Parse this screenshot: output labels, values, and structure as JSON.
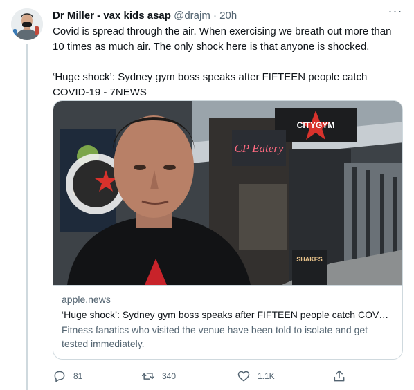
{
  "tweet": {
    "display_name": "Dr Miller - vax kids asap",
    "handle": "@drajm",
    "separator": "·",
    "time": "20h",
    "more": "···",
    "text_paragraph_1": "Covid is spread through the air. When exercising we breath out more than 10 times as much air. The only shock here is that anyone is shocked.",
    "text_paragraph_2": "‘Huge shock’: Sydney gym boss speaks after FIFTEEN people catch COVID-19 - 7NEWS"
  },
  "card": {
    "domain": "apple.news",
    "title": "‘Huge shock’: Sydney gym boss speaks after FIFTEEN people catch COV…",
    "description": "Fitness fanatics who visited the venue have been told to isolate and get tested immediately.",
    "image_signs": {
      "gym_sign": "CITYGYM",
      "eatery_sign": "CP Eatery",
      "board_sign": "SHAKES"
    }
  },
  "actions": {
    "reply_count": "81",
    "retweet_count": "340",
    "like_count": "1.1K"
  },
  "icons": {
    "reply": "reply-icon",
    "retweet": "retweet-icon",
    "like": "heart-icon",
    "share": "share-icon"
  },
  "colors": {
    "text": "#0f1419",
    "secondary": "#536471",
    "border": "#cfd9de"
  }
}
